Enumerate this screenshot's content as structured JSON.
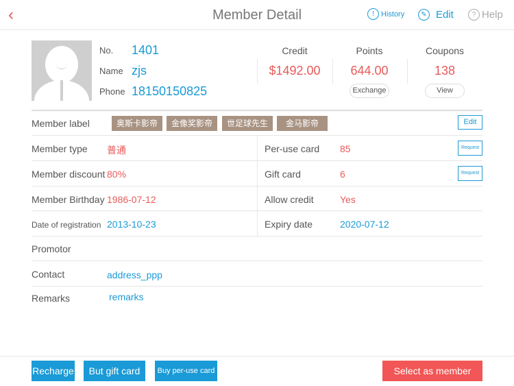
{
  "header": {
    "back_icon": "chevron-left",
    "title": "Member Detail",
    "history": "History",
    "edit": "Edit",
    "help": "Help"
  },
  "profile": {
    "no_label": "No.",
    "no": "1401",
    "name_label": "Name",
    "name": "zjs",
    "phone_label": "Phone",
    "phone": "18150150825"
  },
  "stats": {
    "credit_label": "Credit",
    "credit": "$1492.00",
    "points_label": "Points",
    "points": "644.00",
    "exchange": "Exchange",
    "coupons_label": "Coupons",
    "coupons": "138",
    "view": "View"
  },
  "labels": {
    "title": "Member label",
    "tags": [
      "奥斯卡影帝",
      "金像奖影帝",
      "世足球先生",
      "金马影帝"
    ],
    "edit": "Edit"
  },
  "rows": {
    "member_type_label": "Member type",
    "member_type": "普通",
    "per_use_label": "Per-use card",
    "per_use": "85",
    "request": "Request",
    "discount_label": "Member discount",
    "discount": "80%",
    "gift_label": "Gift card",
    "gift": "6",
    "birthday_label": "Member Birthday",
    "birthday": "1986-07-12",
    "allow_credit_label": "Allow credit",
    "allow_credit": "Yes",
    "reg_label": "Date of registration",
    "reg": "2013-10-23",
    "expiry_label": "Expiry date",
    "expiry": "2020-07-12",
    "promotor_label": "Promotor",
    "contact_label": "Contact",
    "contact": "address_ppp",
    "remarks_label": "Remarks",
    "remarks": "remarks"
  },
  "footer": {
    "recharge": "Recharge",
    "gift": "But gift card",
    "per_use": "Buy per-use card",
    "select": "Select as member"
  }
}
